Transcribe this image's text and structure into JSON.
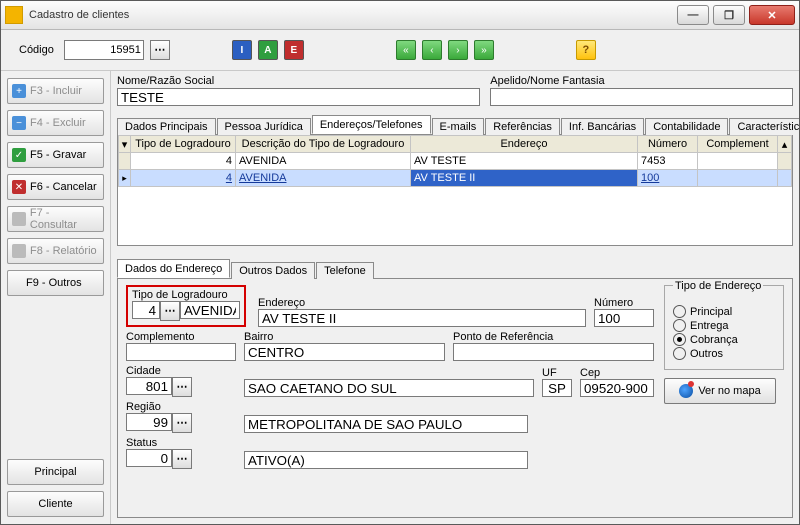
{
  "window": {
    "title": "Cadastro de clientes"
  },
  "toolbar": {
    "codigo_label": "Código",
    "codigo_value": "15951",
    "btn_i": "I",
    "btn_a": "A",
    "btn_e": "E",
    "nav_first": "«",
    "nav_prev": "‹",
    "nav_next": "›",
    "nav_last": "»",
    "help": "?"
  },
  "sidebar": {
    "items": [
      {
        "label": "F3 - Incluir",
        "enabled": false,
        "markClass": "mk-plus",
        "mark": "+"
      },
      {
        "label": "F4 - Excluir",
        "enabled": false,
        "markClass": "mk-minus",
        "mark": "−"
      },
      {
        "label": "F5 - Gravar",
        "enabled": true,
        "markClass": "mk-save",
        "mark": "✓"
      },
      {
        "label": "F6 - Cancelar",
        "enabled": true,
        "markClass": "mk-cancel",
        "mark": "✕"
      },
      {
        "label": "F7 - Consultar",
        "enabled": false,
        "markClass": "mk-query",
        "mark": "🔍"
      },
      {
        "label": "F8 - Relatório",
        "enabled": false,
        "markClass": "mk-report",
        "mark": "📄"
      },
      {
        "label": "F9 - Outros",
        "enabled": true,
        "markClass": "",
        "mark": ""
      }
    ],
    "bottom": [
      "Principal",
      "Cliente"
    ]
  },
  "header": {
    "nome_label": "Nome/Razão Social",
    "nome_value": "TESTE",
    "apelido_label": "Apelido/Nome Fantasia",
    "apelido_value": ""
  },
  "tabs": [
    "Dados Principais",
    "Pessoa Jurídica",
    "Endereços/Telefones",
    "E-mails",
    "Referências",
    "Inf. Bancárias",
    "Contabilidade",
    "Características"
  ],
  "active_tab": 2,
  "grid": {
    "cols": [
      "Tipo de Logradouro",
      "Descrição do Tipo de Logradouro",
      "Endereço",
      "Número",
      "Complement"
    ],
    "rows": [
      {
        "tipo": "4",
        "desc": "AVENIDA",
        "end": "AV TESTE",
        "num": "7453",
        "comp": ""
      },
      {
        "tipo": "4",
        "desc": "AVENIDA",
        "end": "AV TESTE II",
        "num": "100",
        "comp": ""
      }
    ]
  },
  "inner_tabs": [
    "Dados do Endereço",
    "Outros Dados",
    "Telefone"
  ],
  "inner_active": 0,
  "detail": {
    "tipo_log_label": "Tipo de Logradouro",
    "tipo_log_code": "4",
    "tipo_log_desc": "AVENIDA",
    "endereco_label": "Endereço",
    "endereco_value": "AV TESTE II",
    "numero_label": "Número",
    "numero_value": "100",
    "complemento_label": "Complemento",
    "complemento_value": "",
    "bairro_label": "Bairro",
    "bairro_value": "CENTRO",
    "ponto_label": "Ponto de Referência",
    "ponto_value": "",
    "cidade_label": "Cidade",
    "cidade_code": "801",
    "cidade_desc": "SAO CAETANO DO SUL",
    "uf_label": "UF",
    "uf_value": "SP",
    "cep_label": "Cep",
    "cep_value": "09520-900",
    "regiao_label": "Região",
    "regiao_code": "99",
    "regiao_desc": "METROPOLITANA DE SAO PAULO",
    "status_label": "Status",
    "status_code": "0",
    "status_desc": "ATIVO(A)",
    "tipo_end_label": "Tipo de Endereço",
    "tipo_end_options": [
      "Principal",
      "Entrega",
      "Cobrança",
      "Outros"
    ],
    "tipo_end_selected": 2,
    "map_label": "Ver no mapa"
  }
}
